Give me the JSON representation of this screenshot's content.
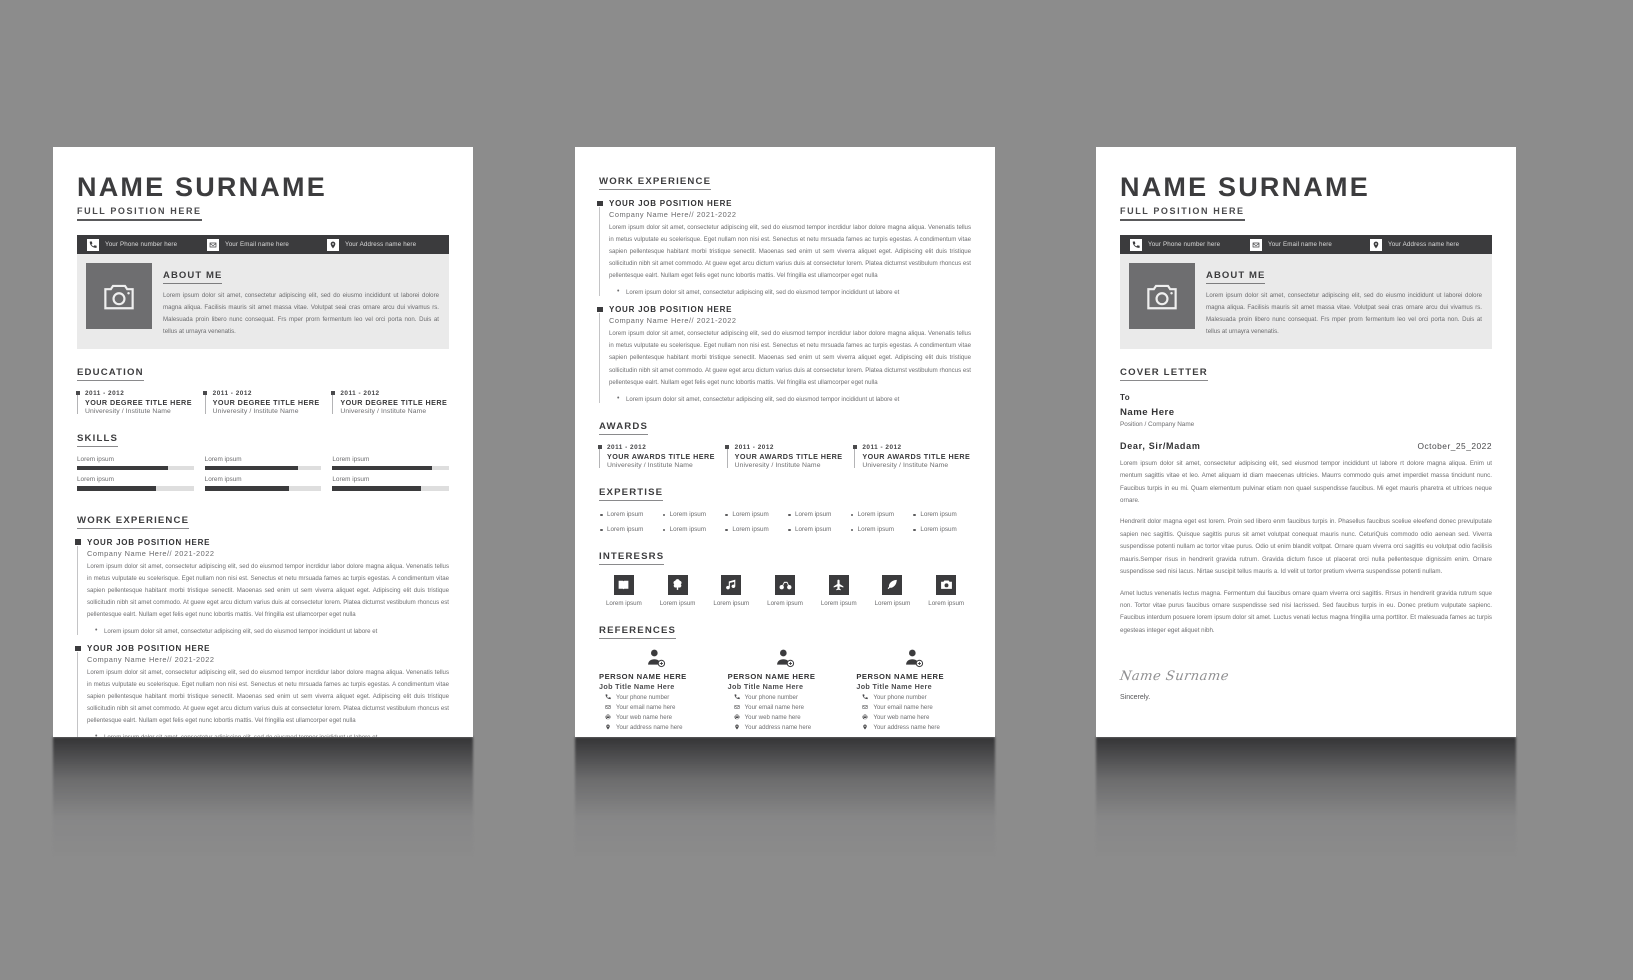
{
  "theme": {
    "background": "#8c8c8c",
    "paper": "#ffffff",
    "dark": "#3b3b3d",
    "light_panel": "#eaeaea",
    "muted_text": "#6e6e70"
  },
  "header": {
    "name": "NAME SURNAME",
    "position": "FULL POSITION HERE",
    "contacts": [
      {
        "icon": "phone-icon",
        "text": "Your Phone number here"
      },
      {
        "icon": "email-icon",
        "text": "Your Email name here"
      },
      {
        "icon": "location-pin-icon",
        "text": "Your Address name here"
      }
    ]
  },
  "about": {
    "title": "ABOUT ME",
    "photo_icon": "camera-icon",
    "text": "Lorem ipsum dolor sit amet, consectetur adipiscing elit, sed do eiusmo incididunt ut laborei dolore magna aliqua. Facilisis mauris sit amet massa vitae. Volutpat seai cras ornare arcu dui vivamus rs. Malesuada proin libero nunc consequat. Frs mper prorn fermentum leo vel orci porta non. Duis at tellus at urnayra venenatis."
  },
  "education": {
    "title": "EDUCATION",
    "items": [
      {
        "year": "2011 - 2012",
        "degree": "YOUR DEGREE TITLE HERE",
        "school": "Univeresity / Institute Name"
      },
      {
        "year": "2011 - 2012",
        "degree": "YOUR DEGREE TITLE HERE",
        "school": "Univeresity / Institute Name"
      },
      {
        "year": "2011 - 2012",
        "degree": "YOUR DEGREE TITLE HERE",
        "school": "Univeresity / Institute Name"
      }
    ]
  },
  "skills": {
    "title": "SKILLS",
    "columns": [
      [
        {
          "label": "Lorem ipsum",
          "value": 78
        },
        {
          "label": "Lorem ipsum",
          "value": 68
        }
      ],
      [
        {
          "label": "Lorem ipsum",
          "value": 80
        },
        {
          "label": "Lorem ipsum",
          "value": 72
        }
      ],
      [
        {
          "label": "Lorem ipsum",
          "value": 85
        },
        {
          "label": "Lorem ipsum",
          "value": 76
        }
      ]
    ]
  },
  "work_experience": {
    "title": "WORK EXPERIENCE",
    "jobs": [
      {
        "title": "YOUR JOB POSITION HERE",
        "company": "Company Name Here// 2021-2022",
        "description": "Lorem ipsum dolor sit amet, consectetur adipiscing elit, sed do eiusmod tempor incrdidur labor dolore magna aliqua. Venenatis tellus in metus vulputate eu scelerisque. Eget nullam non nisi est. Senectus et netu mrsuada fames ac turpis egestas. A condimentum vitae sapien pellentesque habitant morbi tristique senectit. Maoenas sed enim ut sem viverra aliquet eget. Adipiscing elit duis tristique sollicitudin nibh sit amet commodo. At guew eget arcu dictum varius duis at consectetur lorem. Platea dictumst vestibulum rhoncus est pellentesque ealrt. Nullam eget felis eget nunc lobortis mattis. Vel fringilla est ullamcorper eget nulla",
        "bullet": "Lorem ipsum dolor sit amet, consectetur adipiscing elit, sed do eiusmod tempor incididunt ut labore et"
      },
      {
        "title": "YOUR JOB POSITION HERE",
        "company": "Company Name Here// 2021-2022",
        "description": "Lorem ipsum dolor sit amet, consectetur adipiscing elit, sed do eiusmod tempor incrdidur labor dolore magna aliqua. Venenatis tellus in metus vulputate eu scelerisque. Eget nullam non nisi est. Senectus et netu mrsuada fames ac turpis egestas. A condimentum vitae sapien pellentesque habitant morbi tristique senectit. Maoenas sed enim ut sem viverra aliquet eget. Adipiscing elit duis tristique sollicitudin nibh sit amet commodo. At guew eget arcu dictum varius duis at consectetur lorem. Platea dictumst vestibulum rhoncus est pellentesque ealrt. Nullam eget felis eget nunc lobortis mattis. Vel fringilla est ullamcorper eget nulla",
        "bullet": "Lorem ipsum dolor sit amet, consectetur adipiscing elit, sed do eiusmod tempor incididunt ut labore et"
      }
    ]
  },
  "awards": {
    "title": "AWARDS",
    "items": [
      {
        "year": "2011 - 2012",
        "degree": "YOUR AWARDS TITLE HERE",
        "school": "Univeresity / Institute Name"
      },
      {
        "year": "2011 - 2012",
        "degree": "YOUR AWARDS TITLE HERE",
        "school": "Univeresity / Institute Name"
      },
      {
        "year": "2011 - 2012",
        "degree": "YOUR AWARDS TITLE HERE",
        "school": "Univeresity / Institute Name"
      }
    ]
  },
  "expertise": {
    "title": "EXPERTISE",
    "items": [
      "Lorem ipsum",
      "Lorem ipsum",
      "Lorem ipsum",
      "Lorem ipsum",
      "Lorem ipsum",
      "Lorem ipsum",
      "Lorem ipsum",
      "Lorem ipsum",
      "Lorem ipsum",
      "Lorem ipsum",
      "Lorem ipsum",
      "Lorem ipsum"
    ]
  },
  "interests": {
    "title": "INTERESRS",
    "items": [
      {
        "icon": "book-icon",
        "label": "Lorem ipsum"
      },
      {
        "icon": "tree-icon",
        "label": "Lorem ipsum"
      },
      {
        "icon": "music-note-icon",
        "label": "Lorem ipsum"
      },
      {
        "icon": "bicycle-icon",
        "label": "Lorem ipsum"
      },
      {
        "icon": "airplane-icon",
        "label": "Lorem ipsum"
      },
      {
        "icon": "feather-pen-icon",
        "label": "Lorem ipsum"
      },
      {
        "icon": "camera-icon",
        "label": "Lorem ipsum"
      }
    ]
  },
  "references": {
    "title": "REFERENCES",
    "people": [
      {
        "avatar_icon": "user-add-icon",
        "name": "PERSON NAME HERE",
        "job": "Job Title Name Here",
        "lines": [
          {
            "icon": "phone-icon",
            "text": "Your phone number"
          },
          {
            "icon": "email-icon",
            "text": "Your email name here"
          },
          {
            "icon": "globe-icon",
            "text": "Your web name here"
          },
          {
            "icon": "location-pin-icon",
            "text": "Your address name here"
          }
        ]
      },
      {
        "avatar_icon": "user-add-icon",
        "name": "PERSON NAME HERE",
        "job": "Job Title Name Here",
        "lines": [
          {
            "icon": "phone-icon",
            "text": "Your phone number"
          },
          {
            "icon": "email-icon",
            "text": "Your email name here"
          },
          {
            "icon": "globe-icon",
            "text": "Your web name here"
          },
          {
            "icon": "location-pin-icon",
            "text": "Your address name here"
          }
        ]
      },
      {
        "avatar_icon": "user-add-icon",
        "name": "PERSON NAME HERE",
        "job": "Job Title Name Here",
        "lines": [
          {
            "icon": "phone-icon",
            "text": "Your phone number"
          },
          {
            "icon": "email-icon",
            "text": "Your email name here"
          },
          {
            "icon": "globe-icon",
            "text": "Your web name here"
          },
          {
            "icon": "location-pin-icon",
            "text": "Your address name here"
          }
        ]
      }
    ]
  },
  "cover_letter": {
    "title": "COVER LETTER",
    "to_label": "To",
    "recipient_name": "Name Here",
    "recipient_position": "Position / Company Name",
    "salutation": "Dear, Sir/Madam",
    "date": "October_25_2022",
    "paragraphs": [
      "Lorem ipsum dolor sit amet, consectetur adipiscing elit, sed eiusmod tempor incididunt ut labore rt dolore magna aliqua. Enim ut mentum sagittis vitae et leo. Amet aliquam id diam maecenas ultricies. Maurrs commodo quis amet imperdiet massa tincidunt nunc. Faucibus turpis in eu mi. Quam elementum pulvinar etiam non quael suspendisse faucibus. Mi eget mauris pharetra et ultrices neque ornare.",
      "Hendrerit dolor magna eget est lorem. Proin sed libero enm faucibus turpis in. Phasellus faucibus sceliue eleefend donec prevulputate sapien nec sagittis. Quisque sagittis purus sit amet volutpat conequat mauris nunc. CeturiQuis commodo odio aenean sed. Viverra suspendisse potenti nullam ac tortor vitae purus. Odio ut enim blandit voltpat. Ornare quam viverra orci sagittis eu volutpat odio facilisis mauris.Semper risus in hendrerit gravida rutrum. Gravida dictum fusce ut placerat orci nulla pellentesque dignissim enim. Ornare suspendisse sed nisi lacus. Nirtae suscipit tellus mauris a. Id velit ut tortor pretium viverra suspendisse potenti nullam.",
      "Amet luctus venenatis lectus magna. Fermentum dui faucibus ornare quam viverra orci sagittis. Rrsus in hendrerit gravida rutrum sque non. Tortor vitae purus faucibus ornare suspendisse sed nisi lacrissed. Sed faucibus turpis in eu. Donec pretium vulputate sapienc. Faucibus interdum posuere lorem ipsum dolor sit amet. Luctus venati lectus magna fringilla urna porttitor. Et malesuada fames ac turpis egesteas integer eget aliquet nibh."
    ],
    "signature": "Name Surname",
    "sincerely": "Sincerely."
  }
}
